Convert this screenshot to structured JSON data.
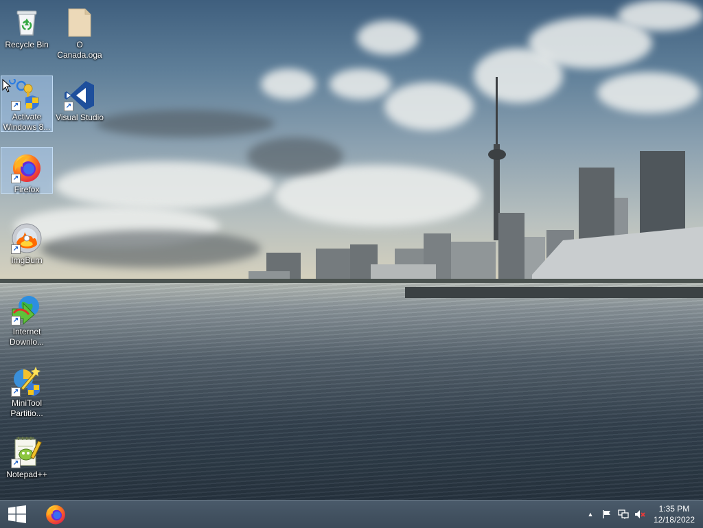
{
  "desktop": {
    "icons": [
      {
        "id": "recycle-bin",
        "label": "Recycle Bin"
      },
      {
        "id": "canada-oga",
        "label": "O Canada.oga"
      },
      {
        "id": "activate-windows",
        "label": "Activate Windows 8..."
      },
      {
        "id": "visual-studio",
        "label": "Visual Studio"
      },
      {
        "id": "firefox",
        "label": "Firefox"
      },
      {
        "id": "imgburn",
        "label": "ImgBurn"
      },
      {
        "id": "internet-download",
        "label": "Internet Downlo..."
      },
      {
        "id": "minitool",
        "label": "MiniTool Partitio..."
      },
      {
        "id": "notepadpp",
        "label": "Notepad++"
      }
    ]
  },
  "taskbar": {
    "clock": {
      "time": "1:35 PM",
      "date": "12/18/2022"
    },
    "tray": {
      "chevron": "▲"
    }
  },
  "colors": {
    "taskbar": "#3b4a58",
    "selection": "#aac8eb",
    "visual_studio": "#1e4f9c",
    "firefox_orange": "#ff7a1a"
  }
}
